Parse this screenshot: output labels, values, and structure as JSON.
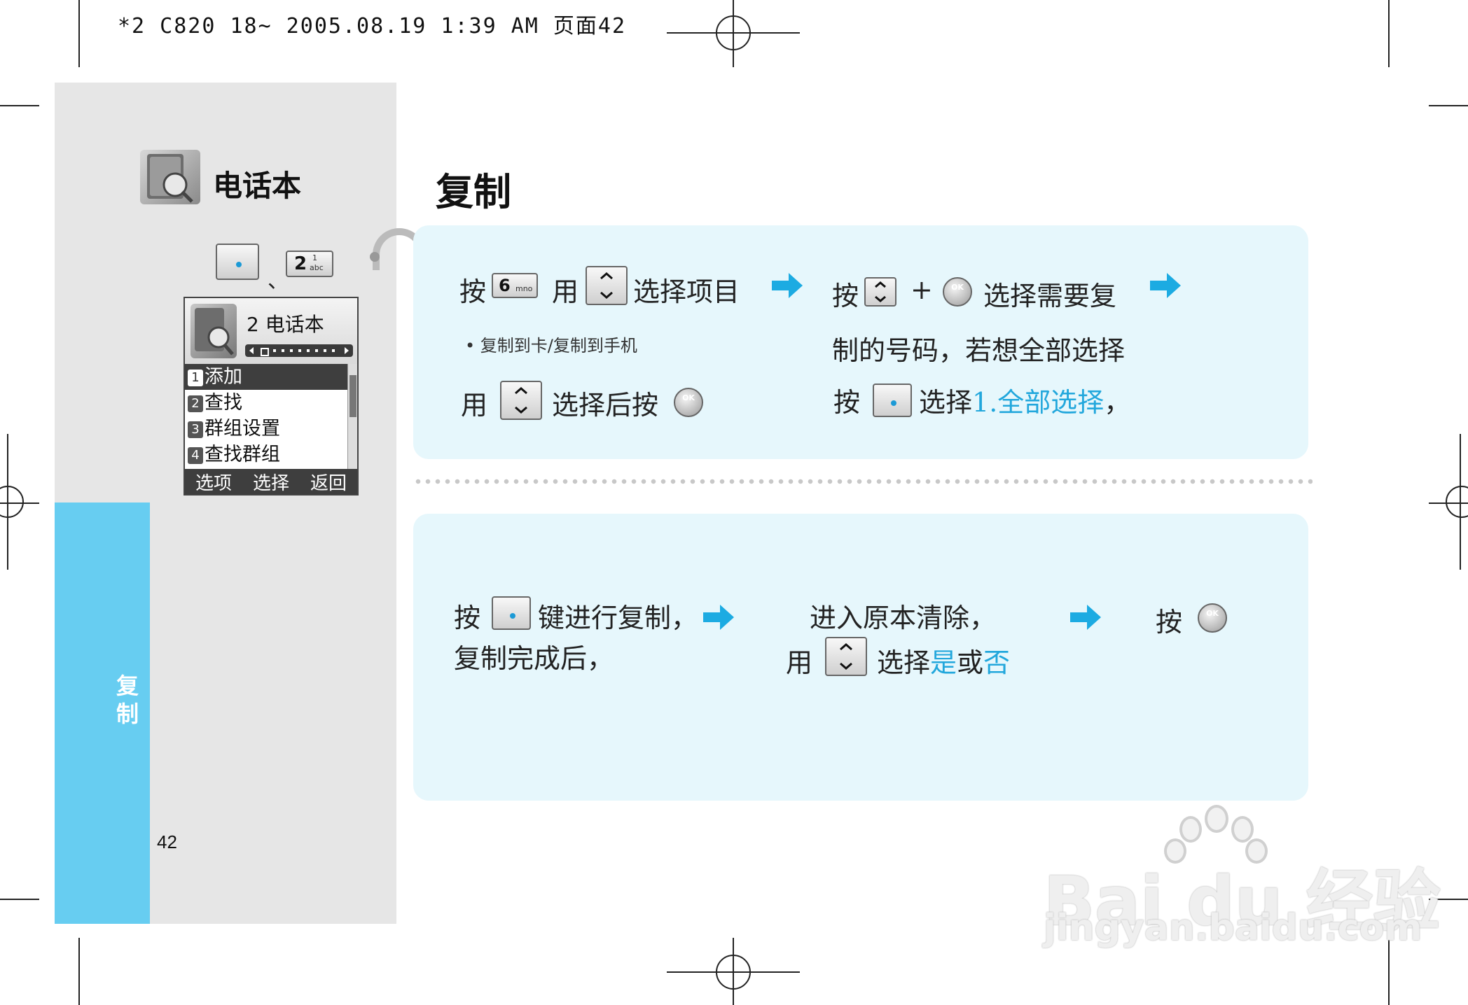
{
  "print_header": "*2 C820 18~ 2005.08.19 1:39 AM 页面42",
  "sidebar": {
    "section_title": "电话本",
    "tab_label": "复制",
    "page_number": "42",
    "key_separator": "、",
    "key_2_label": "2",
    "key_2_sub": "abc",
    "key_2_top": "1"
  },
  "phone_screen": {
    "title": "2 电话本",
    "menu_items": [
      {
        "num": "1",
        "label": "添加"
      },
      {
        "num": "2",
        "label": "查找"
      },
      {
        "num": "3",
        "label": "群组设置"
      },
      {
        "num": "4",
        "label": "查找群组"
      }
    ],
    "softkeys": [
      "选项",
      "选择",
      "返回"
    ]
  },
  "main": {
    "title": "复制",
    "step1": {
      "press": "按",
      "key6_label": "6",
      "key6_sub": "mno",
      "use": "用",
      "select_item": "选择项目",
      "bullet": "复制到卡/复制到手机",
      "use2": "用",
      "select_then_press": "选择后按"
    },
    "step2": {
      "press": "按",
      "plus": "+",
      "select_copy": "选择需要复",
      "line2": "制的号码，若想全部选择",
      "press2": "按",
      "select": "选择",
      "select_all": "1.全部选择",
      "comma": "，"
    },
    "step3": {
      "press": "按",
      "copy_key": "键进行复制，",
      "copy_done": "复制完成后，"
    },
    "step4": {
      "enter": "进入原本清除，",
      "use": "用",
      "select": "选择",
      "yes": "是",
      "or": "或",
      "no": "否"
    },
    "step5": {
      "press": "按"
    },
    "ok_label": "OK"
  },
  "watermark": {
    "brand": "Bai du 经验",
    "url": "jingyan.baidu.com"
  },
  "colors": {
    "accent": "#22a7dc",
    "side_tab": "#67cdf1",
    "box_bg": "#e6f7fc",
    "arrow": "#1cabe2"
  }
}
